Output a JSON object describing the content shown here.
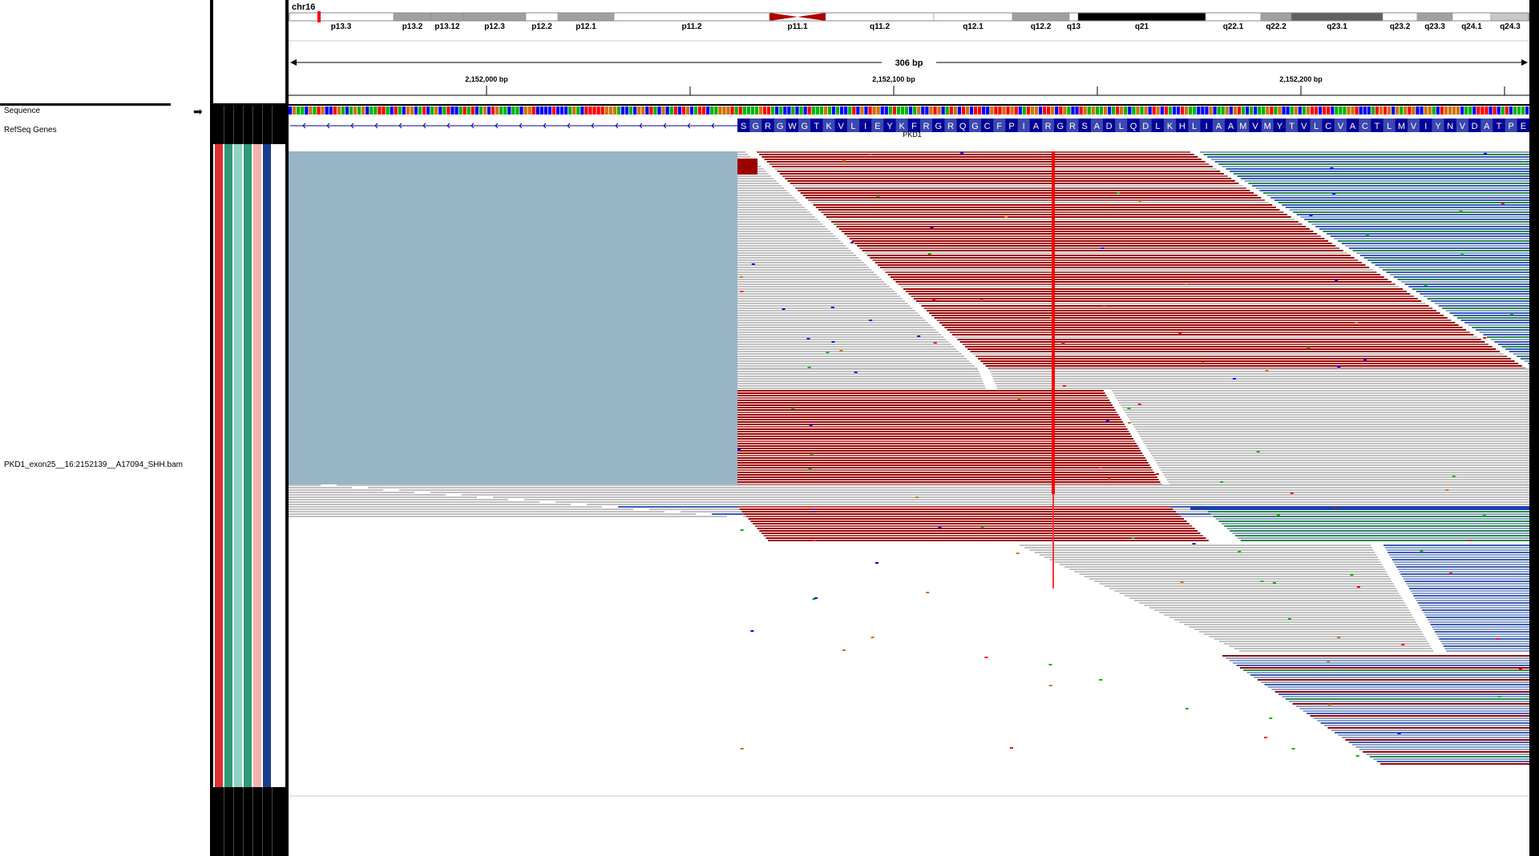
{
  "tracks": {
    "sequence_label": "Sequence",
    "refseq_label": "RefSeq Genes",
    "bam_label": "PKD1_exon25__16:2152139__A17094_SHH.bam"
  },
  "ideogram": {
    "chromosome": "chr16",
    "bands": [
      {
        "name": "p13.3",
        "start": 0,
        "end": 131,
        "stain": "gneg"
      },
      {
        "name": "p13.2",
        "start": 131,
        "end": 178,
        "stain": "gpos50"
      },
      {
        "name": "p13.12",
        "start": 178,
        "end": 218,
        "stain": "gpos50"
      },
      {
        "name": "p12.3",
        "start": 218,
        "end": 296,
        "stain": "gpos50"
      },
      {
        "name": "p12.2",
        "start": 296,
        "end": 336,
        "stain": "gneg"
      },
      {
        "name": "p12.1",
        "start": 336,
        "end": 406,
        "stain": "gpos50"
      },
      {
        "name": "p11.2",
        "start": 406,
        "end": 600,
        "stain": "gneg"
      },
      {
        "name": "p11.1",
        "start": 600,
        "end": 670,
        "stain": "acen"
      },
      {
        "name": "q11.2",
        "start": 670,
        "end": 805,
        "stain": "gneg"
      },
      {
        "name": "q12.1",
        "start": 805,
        "end": 903,
        "stain": "gneg"
      },
      {
        "name": "q12.2",
        "start": 903,
        "end": 974,
        "stain": "gpos50"
      },
      {
        "name": "q13",
        "start": 974,
        "end": 985,
        "stain": "gneg"
      },
      {
        "name": "q21",
        "start": 985,
        "end": 1144,
        "stain": "gpos100"
      },
      {
        "name": "q22.1",
        "start": 1144,
        "end": 1213,
        "stain": "gneg"
      },
      {
        "name": "q22.2",
        "start": 1213,
        "end": 1251,
        "stain": "gpos50"
      },
      {
        "name": "q23.1",
        "start": 1251,
        "end": 1365,
        "stain": "gpos75"
      },
      {
        "name": "q23.2",
        "start": 1365,
        "end": 1408,
        "stain": "gneg"
      },
      {
        "name": "q23.3",
        "start": 1408,
        "end": 1452,
        "stain": "gpos50"
      },
      {
        "name": "q24.1",
        "start": 1452,
        "end": 1500,
        "stain": "gneg"
      },
      {
        "name": "q24.3",
        "start": 1500,
        "end": 1548,
        "stain": "gpos25"
      }
    ]
  },
  "ruler": {
    "span_label": "306 bp",
    "ticks": [
      "2,152,000 bp",
      "2,152,100 bp",
      "2,152,200 bp"
    ]
  },
  "gene": {
    "name": "PKD1",
    "amino_acids": "SGRGWGTKVLIEYKFRGRQGCFPIARGRSADLQDLKHLIAAMVMYTVLCVACTLMVIYNVDATPE"
  },
  "colors": {
    "base_A": "#00b400",
    "base_C": "#0000ff",
    "base_G": "#d17105",
    "base_T": "#ff0000",
    "gene_blue": "#000096",
    "read_gray": "#c0c0c0",
    "insert_large": "#9b0000",
    "insert_small": "#3a5db8",
    "inversion_green": "#2a8a4a",
    "coverage_blue": "#98b5c6",
    "snp_red": "#ff0000",
    "attr_red": "#e03030",
    "attr_teal": "#2e9a78",
    "attr_mint": "#8ed4c2",
    "attr_pink": "#f3b2ad",
    "attr_navy": "#1a3d8f"
  }
}
